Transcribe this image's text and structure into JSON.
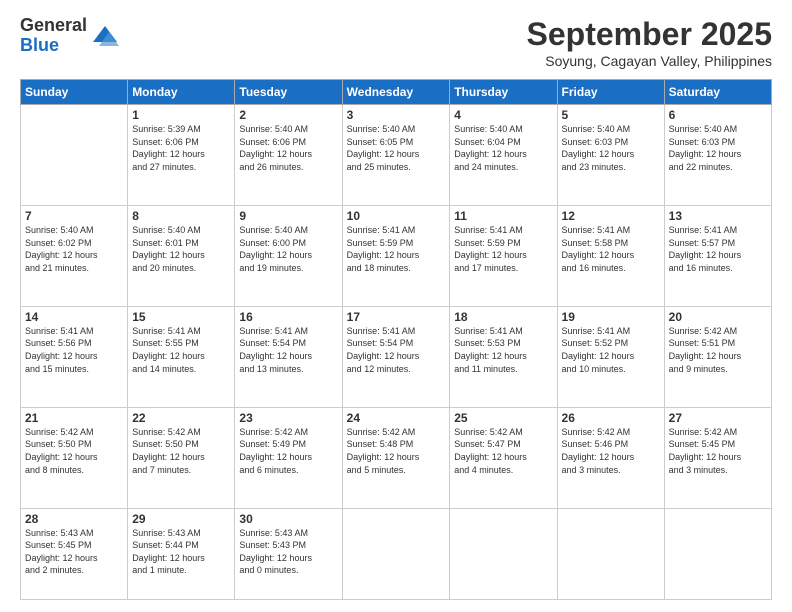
{
  "header": {
    "logo_general": "General",
    "logo_blue": "Blue",
    "title": "September 2025",
    "location": "Soyung, Cagayan Valley, Philippines"
  },
  "days_of_week": [
    "Sunday",
    "Monday",
    "Tuesday",
    "Wednesday",
    "Thursday",
    "Friday",
    "Saturday"
  ],
  "weeks": [
    [
      {
        "day": "",
        "info": ""
      },
      {
        "day": "1",
        "info": "Sunrise: 5:39 AM\nSunset: 6:06 PM\nDaylight: 12 hours\nand 27 minutes."
      },
      {
        "day": "2",
        "info": "Sunrise: 5:40 AM\nSunset: 6:06 PM\nDaylight: 12 hours\nand 26 minutes."
      },
      {
        "day": "3",
        "info": "Sunrise: 5:40 AM\nSunset: 6:05 PM\nDaylight: 12 hours\nand 25 minutes."
      },
      {
        "day": "4",
        "info": "Sunrise: 5:40 AM\nSunset: 6:04 PM\nDaylight: 12 hours\nand 24 minutes."
      },
      {
        "day": "5",
        "info": "Sunrise: 5:40 AM\nSunset: 6:03 PM\nDaylight: 12 hours\nand 23 minutes."
      },
      {
        "day": "6",
        "info": "Sunrise: 5:40 AM\nSunset: 6:03 PM\nDaylight: 12 hours\nand 22 minutes."
      }
    ],
    [
      {
        "day": "7",
        "info": "Sunrise: 5:40 AM\nSunset: 6:02 PM\nDaylight: 12 hours\nand 21 minutes."
      },
      {
        "day": "8",
        "info": "Sunrise: 5:40 AM\nSunset: 6:01 PM\nDaylight: 12 hours\nand 20 minutes."
      },
      {
        "day": "9",
        "info": "Sunrise: 5:40 AM\nSunset: 6:00 PM\nDaylight: 12 hours\nand 19 minutes."
      },
      {
        "day": "10",
        "info": "Sunrise: 5:41 AM\nSunset: 5:59 PM\nDaylight: 12 hours\nand 18 minutes."
      },
      {
        "day": "11",
        "info": "Sunrise: 5:41 AM\nSunset: 5:59 PM\nDaylight: 12 hours\nand 17 minutes."
      },
      {
        "day": "12",
        "info": "Sunrise: 5:41 AM\nSunset: 5:58 PM\nDaylight: 12 hours\nand 16 minutes."
      },
      {
        "day": "13",
        "info": "Sunrise: 5:41 AM\nSunset: 5:57 PM\nDaylight: 12 hours\nand 16 minutes."
      }
    ],
    [
      {
        "day": "14",
        "info": "Sunrise: 5:41 AM\nSunset: 5:56 PM\nDaylight: 12 hours\nand 15 minutes."
      },
      {
        "day": "15",
        "info": "Sunrise: 5:41 AM\nSunset: 5:55 PM\nDaylight: 12 hours\nand 14 minutes."
      },
      {
        "day": "16",
        "info": "Sunrise: 5:41 AM\nSunset: 5:54 PM\nDaylight: 12 hours\nand 13 minutes."
      },
      {
        "day": "17",
        "info": "Sunrise: 5:41 AM\nSunset: 5:54 PM\nDaylight: 12 hours\nand 12 minutes."
      },
      {
        "day": "18",
        "info": "Sunrise: 5:41 AM\nSunset: 5:53 PM\nDaylight: 12 hours\nand 11 minutes."
      },
      {
        "day": "19",
        "info": "Sunrise: 5:41 AM\nSunset: 5:52 PM\nDaylight: 12 hours\nand 10 minutes."
      },
      {
        "day": "20",
        "info": "Sunrise: 5:42 AM\nSunset: 5:51 PM\nDaylight: 12 hours\nand 9 minutes."
      }
    ],
    [
      {
        "day": "21",
        "info": "Sunrise: 5:42 AM\nSunset: 5:50 PM\nDaylight: 12 hours\nand 8 minutes."
      },
      {
        "day": "22",
        "info": "Sunrise: 5:42 AM\nSunset: 5:50 PM\nDaylight: 12 hours\nand 7 minutes."
      },
      {
        "day": "23",
        "info": "Sunrise: 5:42 AM\nSunset: 5:49 PM\nDaylight: 12 hours\nand 6 minutes."
      },
      {
        "day": "24",
        "info": "Sunrise: 5:42 AM\nSunset: 5:48 PM\nDaylight: 12 hours\nand 5 minutes."
      },
      {
        "day": "25",
        "info": "Sunrise: 5:42 AM\nSunset: 5:47 PM\nDaylight: 12 hours\nand 4 minutes."
      },
      {
        "day": "26",
        "info": "Sunrise: 5:42 AM\nSunset: 5:46 PM\nDaylight: 12 hours\nand 3 minutes."
      },
      {
        "day": "27",
        "info": "Sunrise: 5:42 AM\nSunset: 5:45 PM\nDaylight: 12 hours\nand 3 minutes."
      }
    ],
    [
      {
        "day": "28",
        "info": "Sunrise: 5:43 AM\nSunset: 5:45 PM\nDaylight: 12 hours\nand 2 minutes."
      },
      {
        "day": "29",
        "info": "Sunrise: 5:43 AM\nSunset: 5:44 PM\nDaylight: 12 hours\nand 1 minute."
      },
      {
        "day": "30",
        "info": "Sunrise: 5:43 AM\nSunset: 5:43 PM\nDaylight: 12 hours\nand 0 minutes."
      },
      {
        "day": "",
        "info": ""
      },
      {
        "day": "",
        "info": ""
      },
      {
        "day": "",
        "info": ""
      },
      {
        "day": "",
        "info": ""
      }
    ]
  ]
}
